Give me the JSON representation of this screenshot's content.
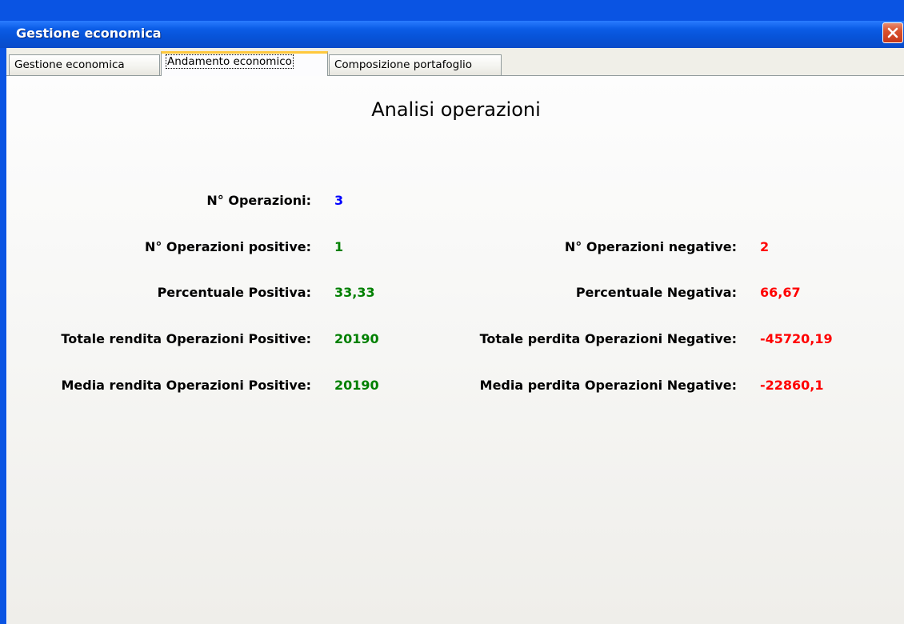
{
  "window": {
    "title": "Gestione economica"
  },
  "tabs": [
    {
      "label": "Gestione economica",
      "active": false
    },
    {
      "label": "Andamento economico",
      "active": true
    },
    {
      "label": "Composizione portafoglio",
      "active": false
    }
  ],
  "panel": {
    "title": "Analisi operazioni",
    "operazioni": {
      "label": "N° Operazioni:",
      "value": "3"
    },
    "positive": {
      "label": "N° Operazioni positive:",
      "value": "1"
    },
    "negative": {
      "label": "N° Operazioni negative:",
      "value": "2"
    },
    "perc_pos": {
      "label": "Percentuale Positiva:",
      "value": "33,33"
    },
    "perc_neg": {
      "label": "Percentuale Negativa:",
      "value": "66,67"
    },
    "tot_pos": {
      "label": "Totale rendita Operazioni Positive:",
      "value": "20190"
    },
    "tot_neg": {
      "label": "Totale perdita Operazioni Negative:",
      "value": "-45720,19"
    },
    "media_pos": {
      "label": "Media rendita Operazioni Positive:",
      "value": "20190"
    },
    "media_neg": {
      "label": "Media perdita Operazioni Negative:",
      "value": "-22860,1"
    }
  },
  "colors": {
    "count": "#0000ff",
    "positive": "#008000",
    "negative": "#ff0000"
  },
  "icons": {
    "close": "close-icon"
  }
}
